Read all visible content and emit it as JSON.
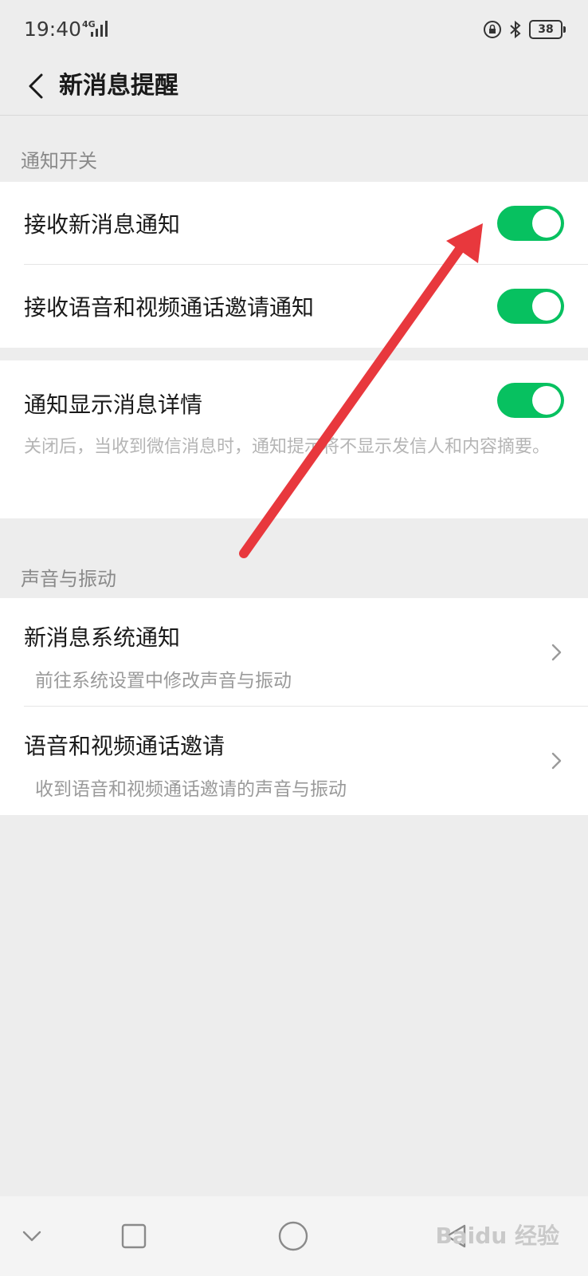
{
  "status": {
    "time": "19:40",
    "network": "4G",
    "battery": "38"
  },
  "header": {
    "title": "新消息提醒"
  },
  "sections": {
    "notify": {
      "title": "通知开关",
      "rows": [
        {
          "label": "接收新消息通知",
          "enabled": true
        },
        {
          "label": "接收语音和视频通话邀请通知",
          "enabled": true
        }
      ],
      "detail": {
        "label": "通知显示消息详情",
        "enabled": true,
        "desc": "关闭后，当收到微信消息时，通知提示将不显示发信人和内容摘要。"
      }
    },
    "sound": {
      "title": "声音与振动",
      "rows": [
        {
          "label": "新消息系统通知",
          "sub": "前往系统设置中修改声音与振动"
        },
        {
          "label": "语音和视频通话邀请",
          "sub": "收到语音和视频通话邀请的声音与振动"
        }
      ]
    }
  },
  "watermark": "Baidu 经验",
  "colors": {
    "toggle_on": "#07c160",
    "annotation_arrow": "#e8383d",
    "background": "#ededed"
  },
  "icons": [
    "back-arrow-icon",
    "chevron-right-icon",
    "lock-icon",
    "bluetooth-icon",
    "signal-icon",
    "battery-icon",
    "nav-back-icon",
    "nav-home-icon",
    "nav-recent-icon"
  ]
}
